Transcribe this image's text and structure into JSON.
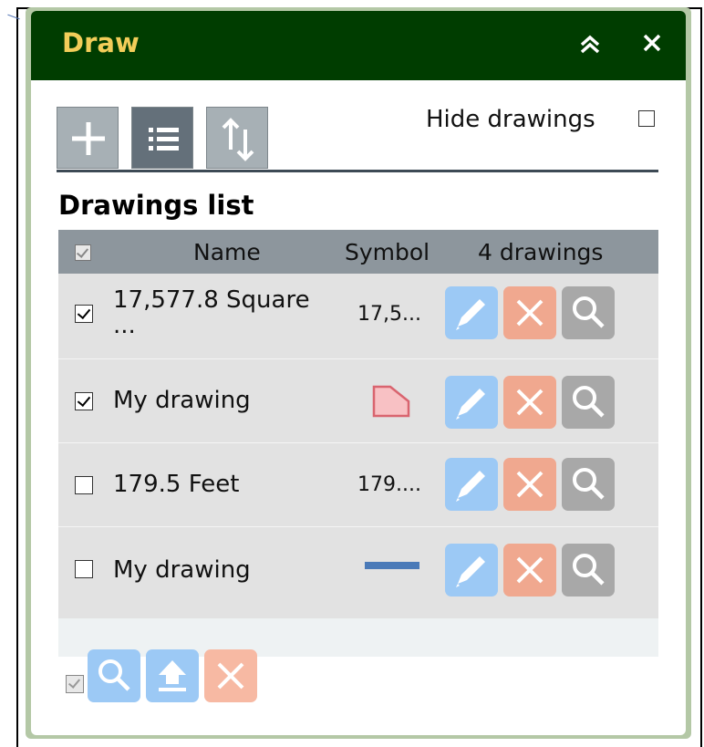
{
  "panel": {
    "title": "Draw",
    "hide_drawings_label": "Hide drawings",
    "hide_drawings_checked": false
  },
  "tabs": [
    {
      "name": "add",
      "icon": "plus-icon",
      "active": false
    },
    {
      "name": "list",
      "icon": "list-icon",
      "active": true
    },
    {
      "name": "import-export",
      "icon": "import-export-icon",
      "active": false
    }
  ],
  "list": {
    "heading": "Drawings list",
    "columns": {
      "name": "Name",
      "symbol": "Symbol",
      "count": "4 drawings"
    },
    "rows": [
      {
        "checked": true,
        "name_line1": "17,577.8 Square",
        "name_line2": "...",
        "symbol_text": "17,5...",
        "symbol_type": "text"
      },
      {
        "checked": true,
        "name_line1": "My drawing",
        "name_line2": "",
        "symbol_text": "",
        "symbol_type": "polygon"
      },
      {
        "checked": false,
        "name_line1": "179.5 Feet",
        "name_line2": "",
        "symbol_text": "179....",
        "symbol_type": "text"
      },
      {
        "checked": false,
        "name_line1": "My drawing",
        "name_line2": "",
        "symbol_text": "",
        "symbol_type": "line"
      }
    ]
  },
  "colors": {
    "titlebar": "#003d00",
    "title_text": "#f2cd59",
    "edit_button": "#9cc9f5",
    "delete_button": "#f0a88f",
    "zoom_button": "#a8a8a8",
    "polygon_fill": "#f8c1c4",
    "polygon_stroke": "#d9646f",
    "line_symbol": "#4a7ab8"
  }
}
